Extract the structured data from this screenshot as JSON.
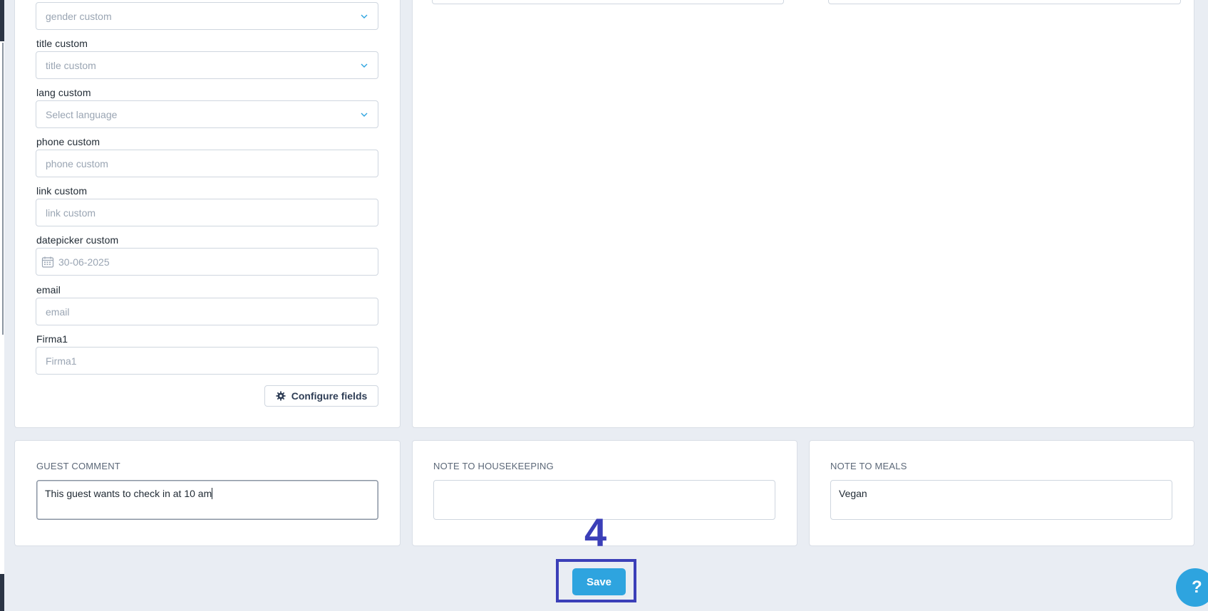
{
  "form": {
    "fields": [
      {
        "id": "gender",
        "label": "",
        "placeholder": "gender custom",
        "type": "select"
      },
      {
        "id": "title",
        "label": "title custom",
        "placeholder": "title custom",
        "type": "select"
      },
      {
        "id": "lang",
        "label": "lang custom",
        "placeholder": "Select language",
        "type": "select"
      },
      {
        "id": "phone",
        "label": "phone custom",
        "placeholder": "phone custom",
        "type": "text"
      },
      {
        "id": "link",
        "label": "link custom",
        "placeholder": "link custom",
        "type": "text"
      },
      {
        "id": "datepicker",
        "label": "datepicker custom",
        "placeholder": "30-06-2025",
        "type": "date"
      },
      {
        "id": "email",
        "label": "email",
        "placeholder": "email",
        "type": "text"
      },
      {
        "id": "firma1",
        "label": "Firma1",
        "placeholder": "Firma1",
        "type": "text"
      }
    ],
    "configure_label": "Configure fields"
  },
  "notes": {
    "guest_comment": {
      "title": "GUEST COMMENT",
      "value": "This guest wants to check in at 10 am"
    },
    "housekeeping": {
      "title": "NOTE TO HOUSEKEEPING",
      "value": ""
    },
    "meals": {
      "title": "NOTE TO MEALS",
      "value": "Vegan"
    }
  },
  "annotation": {
    "step": "4"
  },
  "actions": {
    "save_label": "Save",
    "help_label": "?"
  },
  "colors": {
    "accent": "#2ea4df",
    "annotation": "#3b3fb8",
    "background": "#e9edf3"
  },
  "icons": {
    "select": "chevron-down-icon",
    "date": "calendar-icon",
    "configure": "gear-icon"
  }
}
